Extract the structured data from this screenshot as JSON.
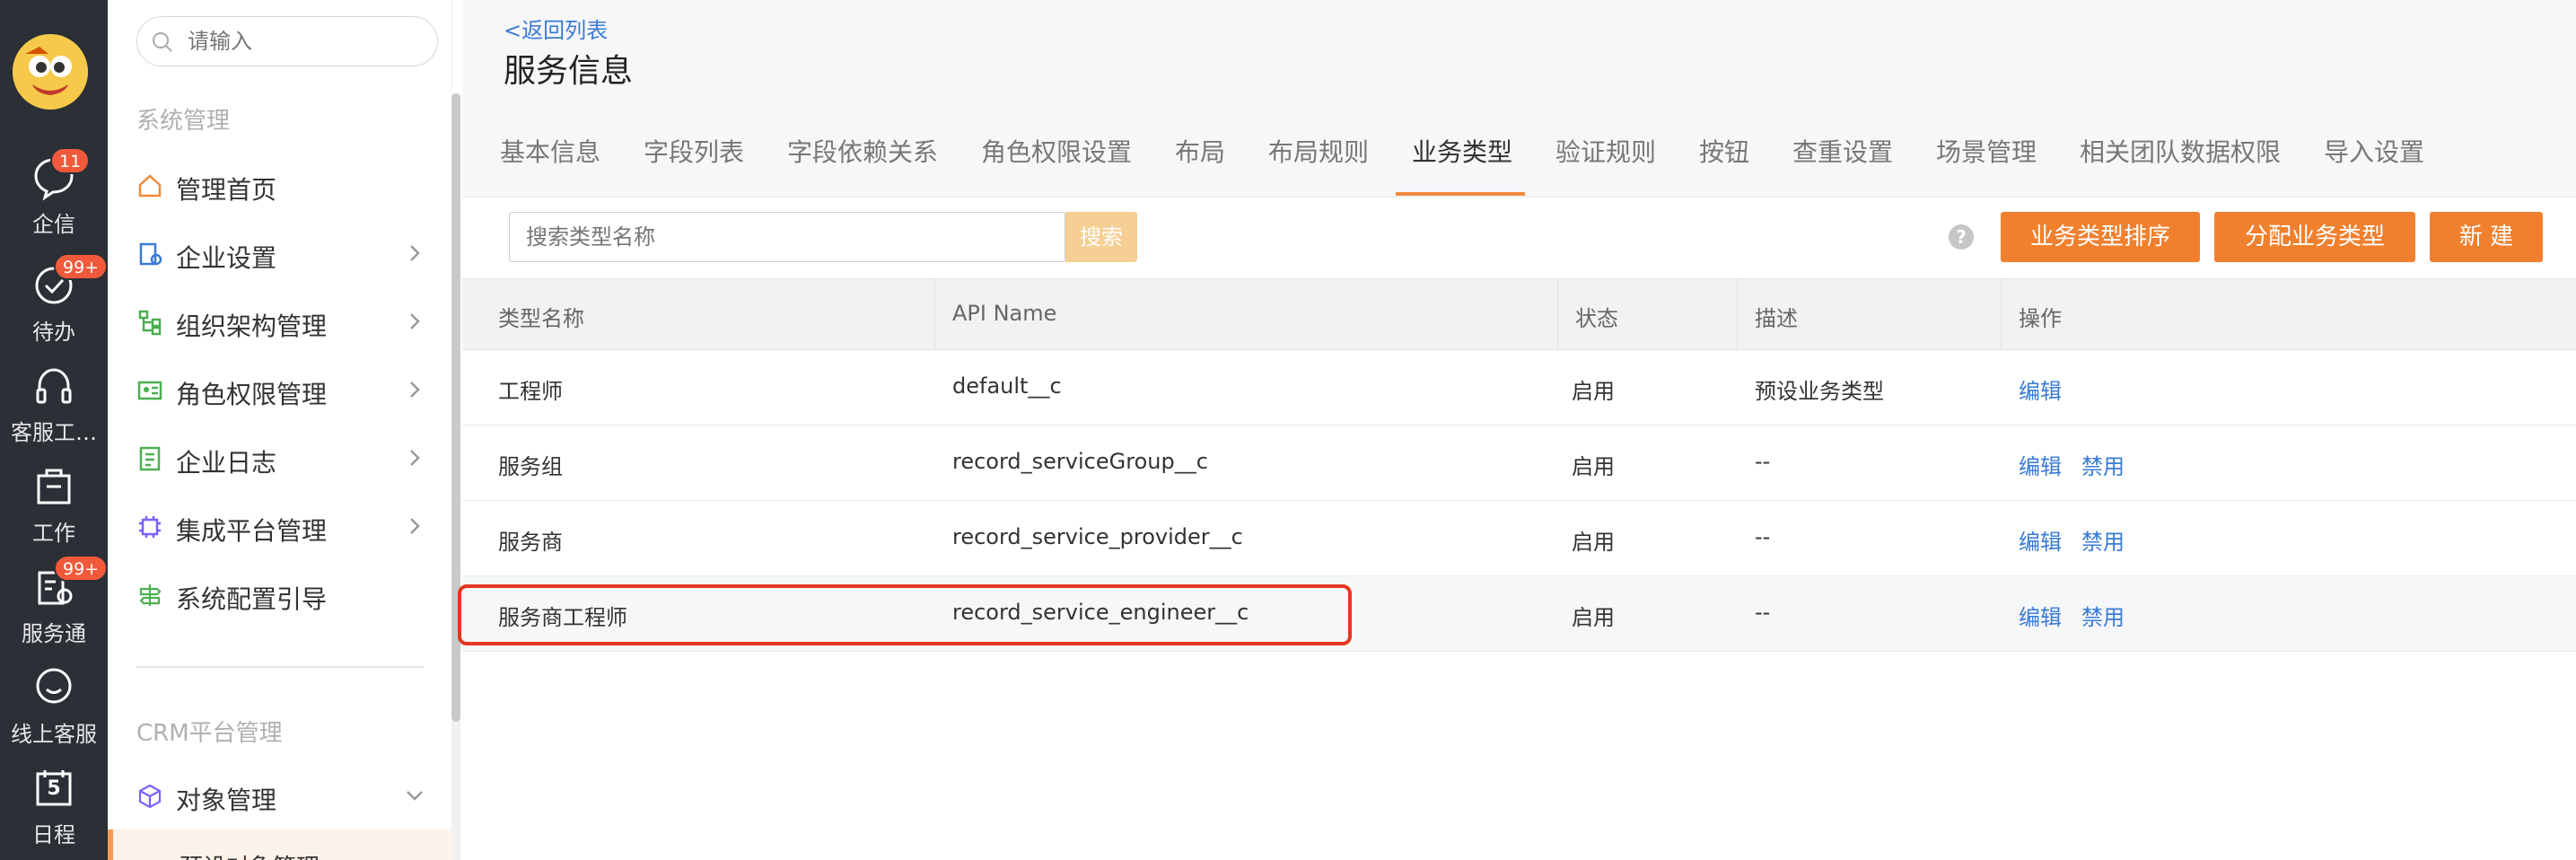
{
  "rail": {
    "items": [
      {
        "label": "企信",
        "badge": "11",
        "icon": "chat-bubble-icon"
      },
      {
        "label": "待办",
        "badge": "99+",
        "icon": "check-circle-icon"
      },
      {
        "label": "客服工…",
        "badge": "",
        "icon": "headset-icon"
      },
      {
        "label": "工作",
        "badge": "",
        "icon": "briefcase-icon"
      },
      {
        "label": "服务通",
        "badge": "99+",
        "icon": "service-tool-icon"
      },
      {
        "label": "线上客服",
        "badge": "",
        "icon": "smile-chat-icon"
      },
      {
        "label": "日程",
        "badge": "",
        "icon": "calendar-icon",
        "day": "5"
      }
    ]
  },
  "sidebar": {
    "search_placeholder": "请输入",
    "section_system": "系统管理",
    "items": [
      {
        "label": "管理首页",
        "icon": "home-icon",
        "color": "#f08a3a"
      },
      {
        "label": "企业设置",
        "icon": "building-icon",
        "color": "#3a7bd5"
      },
      {
        "label": "组织架构管理",
        "icon": "org-tree-icon",
        "color": "#4caf50"
      },
      {
        "label": "角色权限管理",
        "icon": "id-card-icon",
        "color": "#4caf50"
      },
      {
        "label": "企业日志",
        "icon": "log-icon",
        "color": "#4caf50"
      },
      {
        "label": "集成平台管理",
        "icon": "chip-icon",
        "color": "#7b61ff"
      },
      {
        "label": "系统配置引导",
        "icon": "guide-icon",
        "color": "#4caf50"
      }
    ],
    "section_crm": "CRM平台管理",
    "crm_item": {
      "label": "对象管理",
      "icon": "cube-icon"
    },
    "crm_sub": "预设对象管理"
  },
  "header": {
    "back_label": "<返回列表",
    "title": "服务信息"
  },
  "tabs": [
    "基本信息",
    "字段列表",
    "字段依赖关系",
    "角色权限设置",
    "布局",
    "布局规则",
    "业务类型",
    "验证规则",
    "按钮",
    "查重设置",
    "场景管理",
    "相关团队数据权限",
    "导入设置"
  ],
  "active_tab": "业务类型",
  "toolbar": {
    "search_placeholder": "搜索类型名称",
    "search_button": "搜索",
    "help": "?",
    "btn_sort": "业务类型排序",
    "btn_assign": "分配业务类型",
    "btn_new": "新 建"
  },
  "table": {
    "headers": [
      "类型名称",
      "API Name",
      "状态",
      "描述",
      "操作"
    ],
    "rows": [
      {
        "name": "工程师",
        "api": "default__c",
        "status": "启用",
        "desc": "预设业务类型",
        "edit": "编辑",
        "disable": ""
      },
      {
        "name": "服务组",
        "api": "record_serviceGroup__c",
        "status": "启用",
        "desc": "--",
        "edit": "编辑",
        "disable": "禁用"
      },
      {
        "name": "服务商",
        "api": "record_service_provider__c",
        "status": "启用",
        "desc": "--",
        "edit": "编辑",
        "disable": "禁用"
      },
      {
        "name": "服务商工程师",
        "api": "record_service_engineer__c",
        "status": "启用",
        "desc": "--",
        "edit": "编辑",
        "disable": "禁用"
      }
    ]
  },
  "colors": {
    "accent": "#f0802e",
    "link": "#3a7bd5",
    "rail_bg": "#2b2f36",
    "highlight": "#e2381f"
  }
}
